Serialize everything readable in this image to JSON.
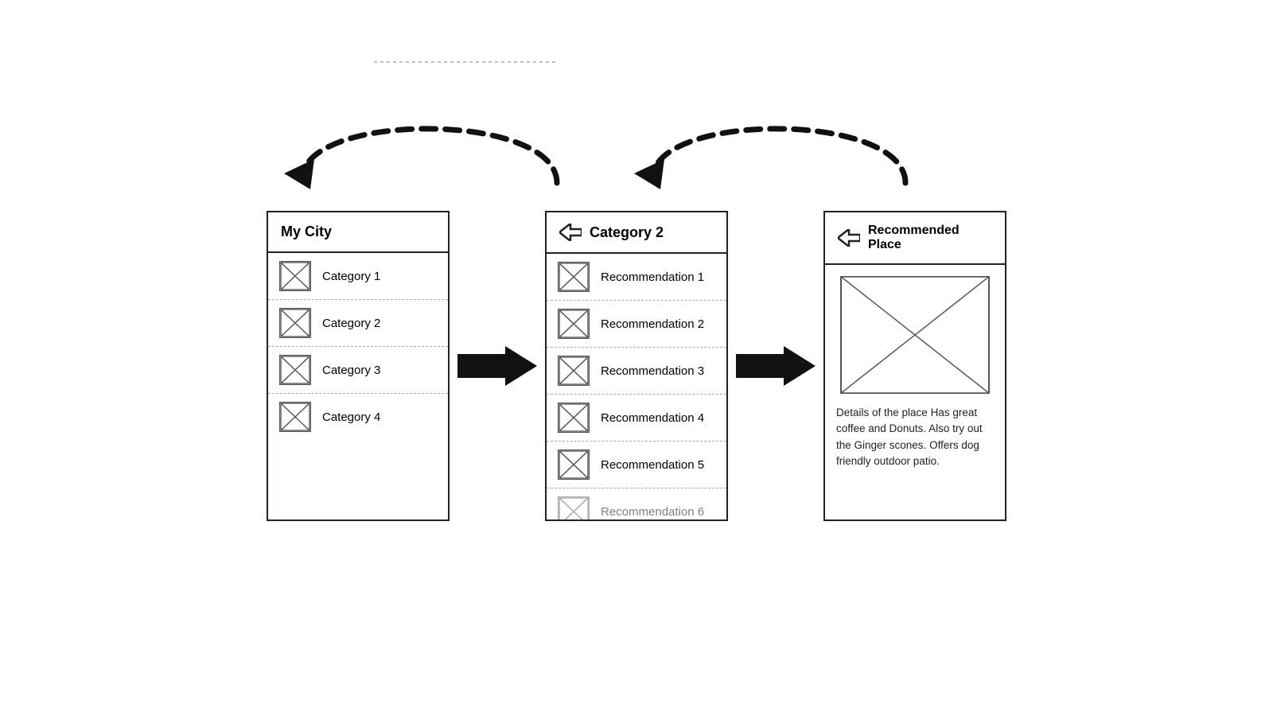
{
  "top_line": {
    "visible": true
  },
  "panel_city": {
    "title": "My City",
    "items": [
      {
        "label": "Category 1"
      },
      {
        "label": "Category 2"
      },
      {
        "label": "Category 3"
      },
      {
        "label": "Category 4"
      }
    ]
  },
  "panel_category": {
    "title": "Category 2",
    "has_back": true,
    "items": [
      {
        "label": "Recommendation 1"
      },
      {
        "label": "Recommendation 2"
      },
      {
        "label": "Recommendation 3"
      },
      {
        "label": "Recommendation 4"
      },
      {
        "label": "Recommendation 5"
      },
      {
        "label": "Recommendation 6"
      }
    ]
  },
  "panel_place": {
    "title": "Recommended Place",
    "has_back": true,
    "details": "Details of the place\nHas great coffee and Donuts. Also try out the Ginger scones.\nOffers dog friendly outdoor patio."
  },
  "arrows": {
    "forward_1_label": "→",
    "forward_2_label": "→"
  }
}
